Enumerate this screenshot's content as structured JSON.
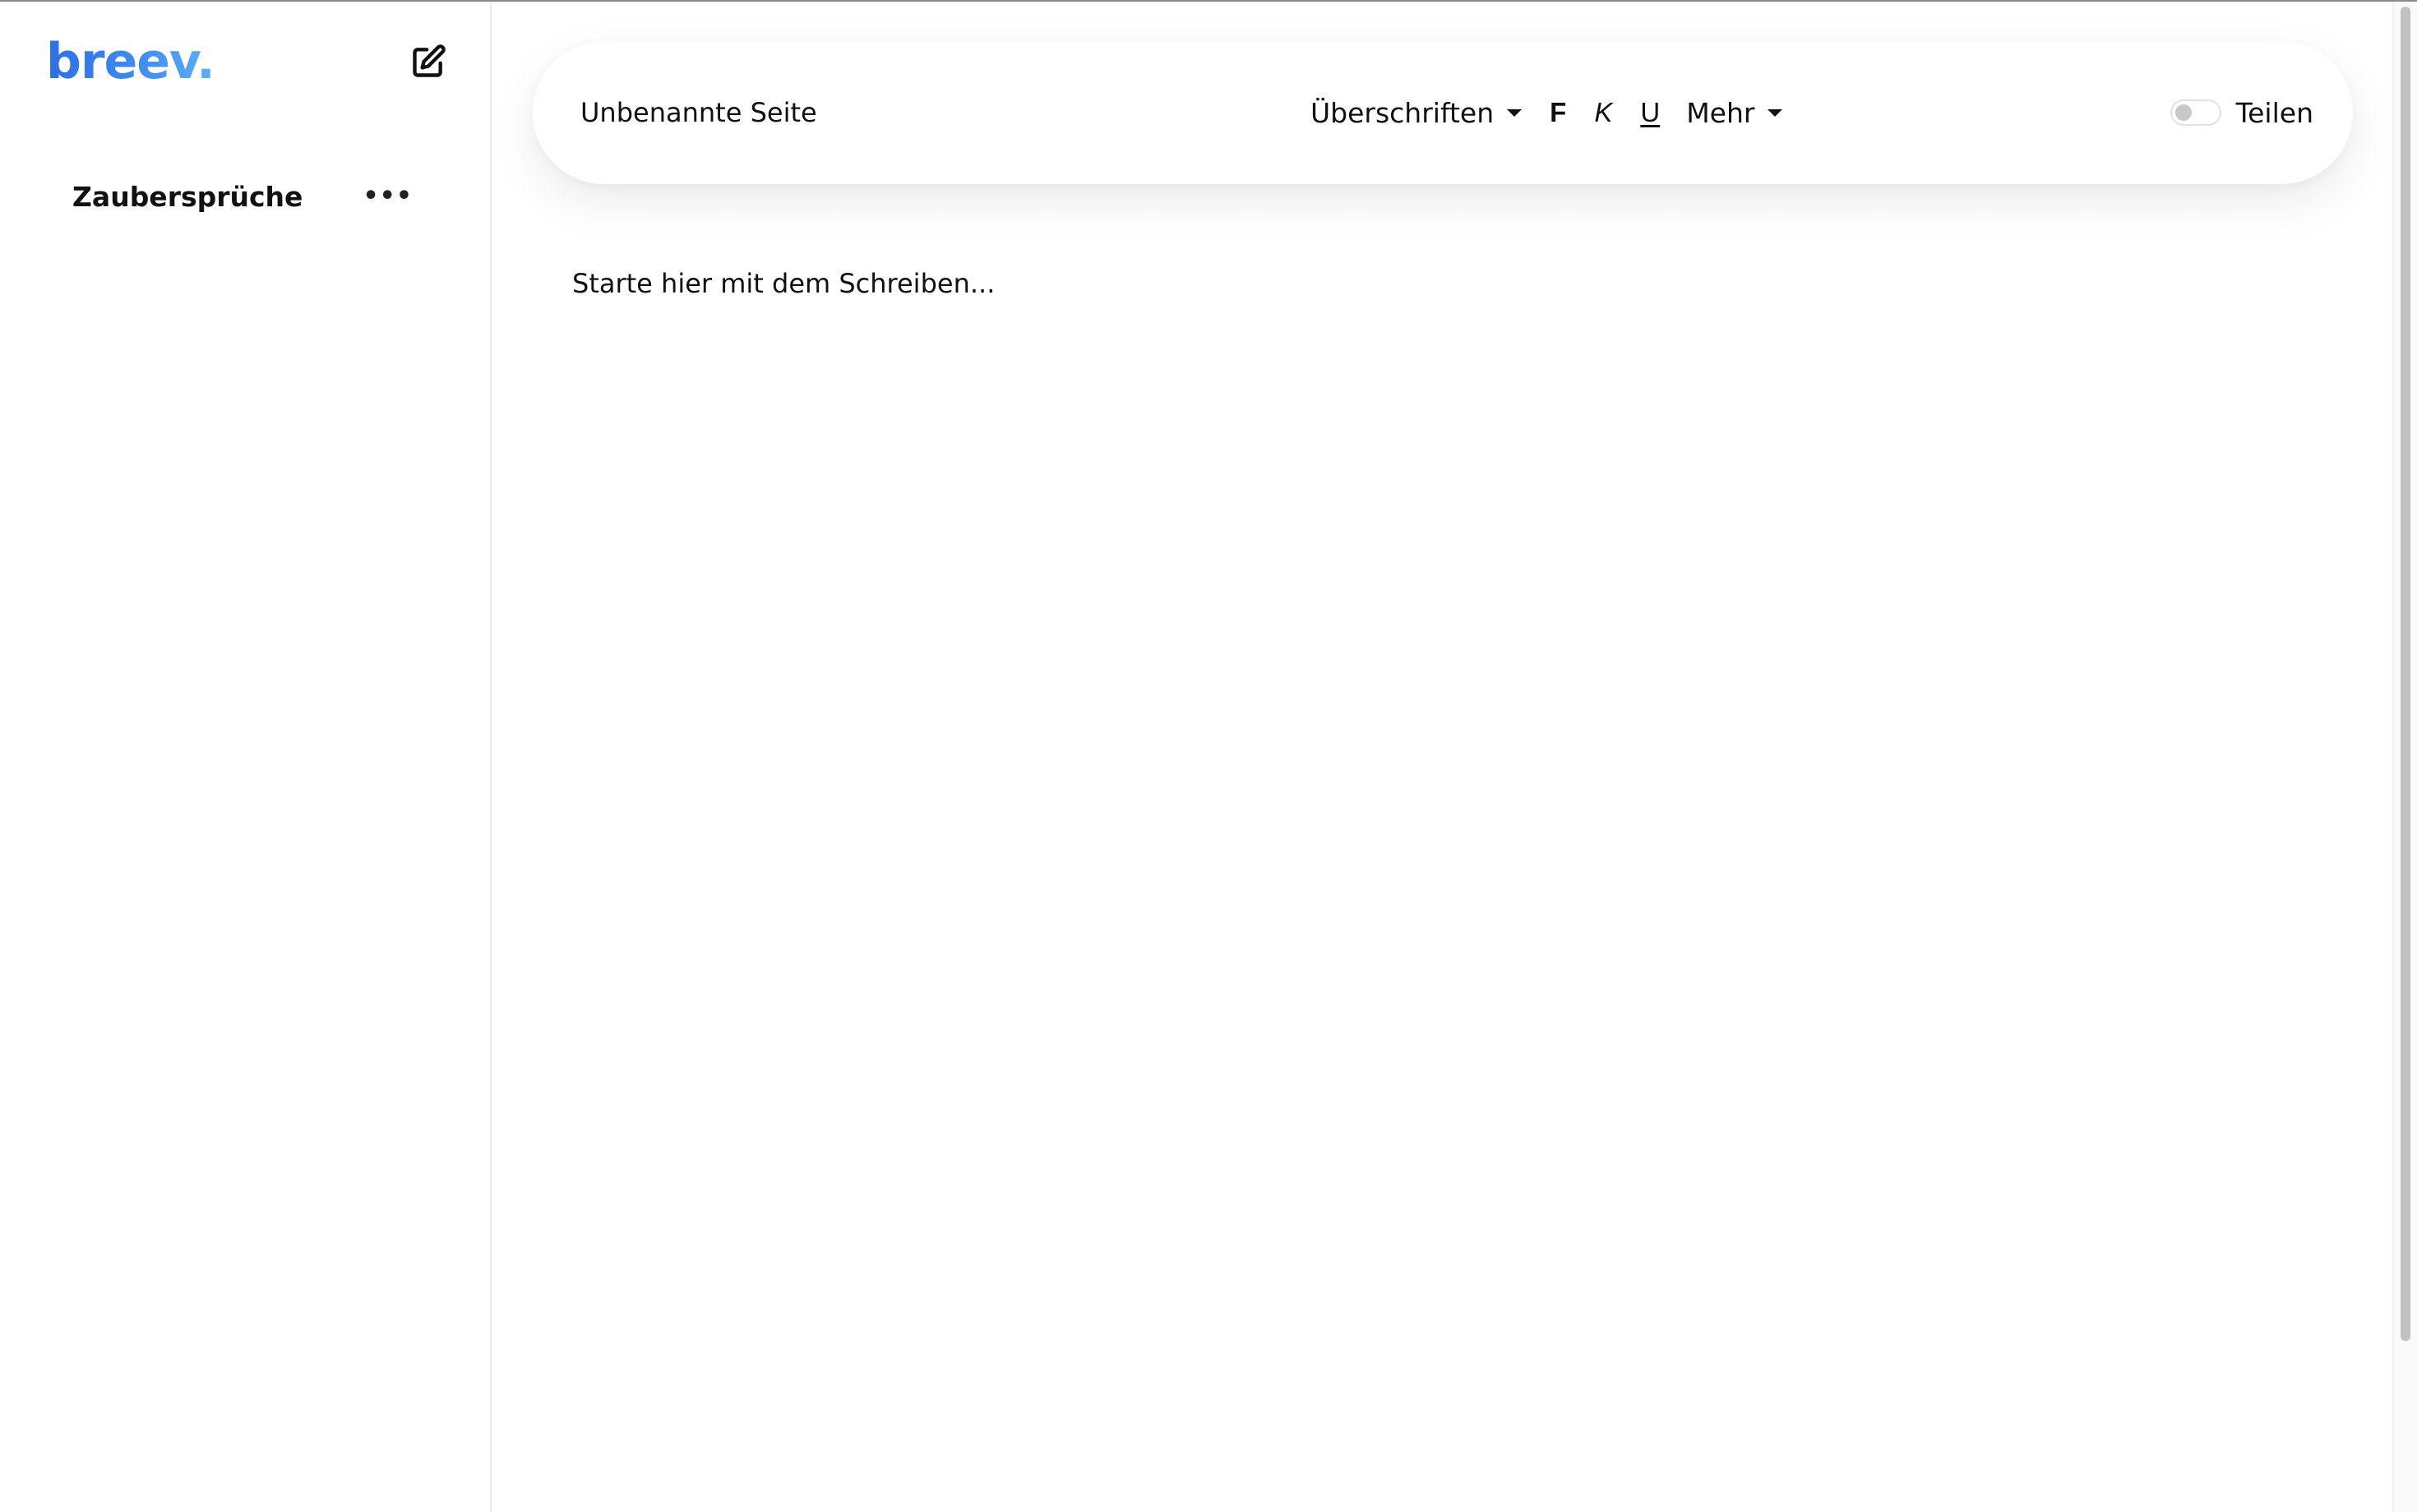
{
  "app": {
    "logo": "breev."
  },
  "sidebar": {
    "items": [
      {
        "label": "Zaubersprüche",
        "menu": "•••"
      }
    ]
  },
  "toolbar": {
    "page_title": "Unbenannte Seite",
    "headings_label": "Überschriften",
    "bold_label": "F",
    "italic_label": "K",
    "underline_label": "U",
    "more_label": "Mehr",
    "share_label": "Teilen",
    "share_enabled": false
  },
  "editor": {
    "placeholder": "Starte hier mit dem Schreiben..."
  },
  "icons": {
    "new_page": "edit-icon",
    "more": "more-horizontal-icon",
    "caret": "chevron-down-icon"
  }
}
